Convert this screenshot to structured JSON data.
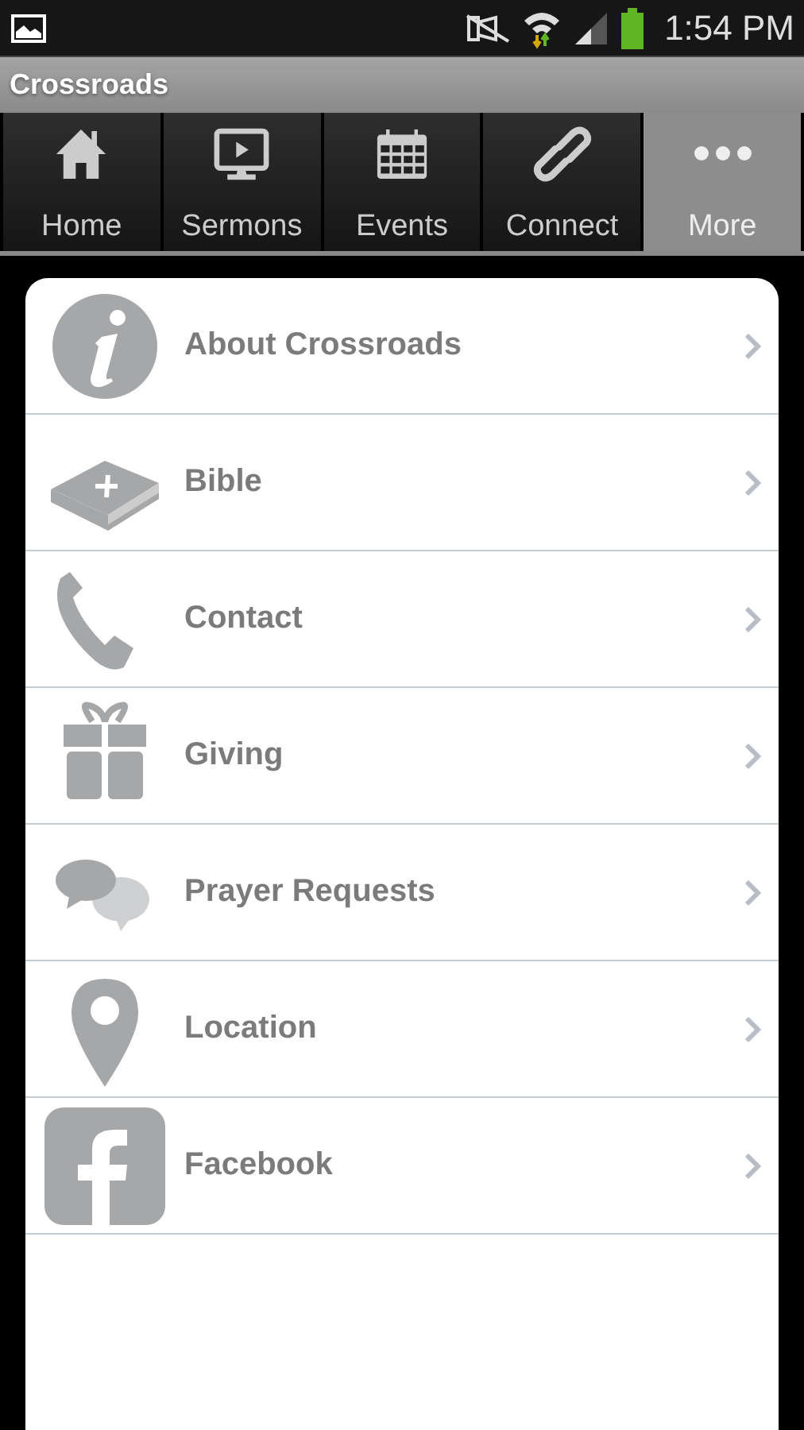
{
  "status_bar": {
    "time": "1:54 PM"
  },
  "app_bar": {
    "title": "Crossroads"
  },
  "tabs": [
    {
      "label": "Home",
      "selected": false
    },
    {
      "label": "Sermons",
      "selected": false
    },
    {
      "label": "Events",
      "selected": false
    },
    {
      "label": "Connect",
      "selected": false
    },
    {
      "label": "More",
      "selected": true
    }
  ],
  "menu": [
    {
      "label": "About Crossroads"
    },
    {
      "label": "Bible"
    },
    {
      "label": "Contact"
    },
    {
      "label": "Giving"
    },
    {
      "label": "Prayer Requests"
    },
    {
      "label": "Location"
    },
    {
      "label": "Facebook"
    }
  ]
}
